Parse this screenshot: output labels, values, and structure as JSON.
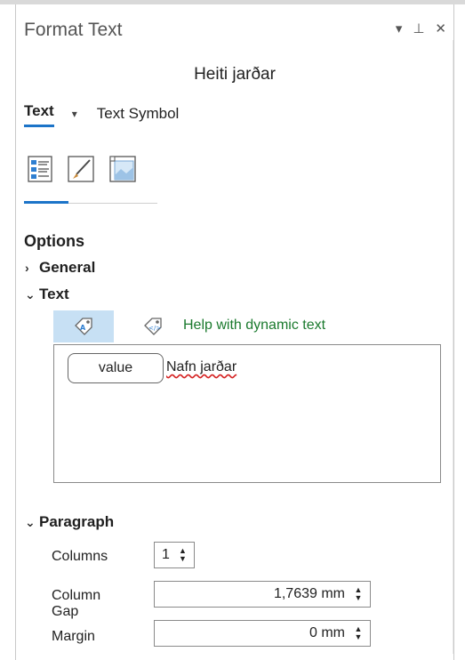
{
  "panel": {
    "title": "Format Text",
    "controls": {
      "menu": "▾",
      "pin": "⊥",
      "close": "✕"
    }
  },
  "element_name": "Heiti jarðar",
  "tabs": {
    "text": "Text",
    "dropdown": "▾",
    "text_symbol": "Text Symbol"
  },
  "icons": {
    "properties": "properties-list-icon",
    "style": "paintbrush-icon",
    "frame": "frame-icon",
    "insert_attribute": "tag-icon",
    "insert_dynamic": "dynamic-tag-icon"
  },
  "options": {
    "heading": "Options",
    "general_label": "General",
    "text_label": "Text",
    "help_link": "Help with dynamic text",
    "value_chip": "value",
    "text_content": "Nafn jarðar",
    "paragraph_label": "Paragraph",
    "chevron_collapsed": "›",
    "chevron_expanded": "⌄"
  },
  "paragraph": {
    "columns_label": "Columns",
    "columns_value": "1",
    "column_gap_label": "Column Gap",
    "column_gap_value": "1,7639 mm",
    "margin_label": "Margin",
    "margin_value": "0 mm",
    "spin_up": "▲",
    "spin_down": "▼"
  },
  "colors": {
    "accent": "#1c74c8",
    "selected_bg": "#c7e0f4",
    "link": "#1b7a2e",
    "spell_error": "#d42020"
  }
}
